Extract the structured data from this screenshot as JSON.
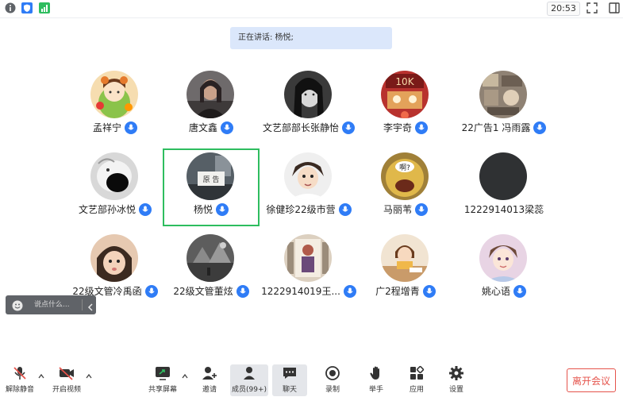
{
  "status": {
    "time": "20:53"
  },
  "speaker_banner": {
    "text": "正在讲话: 杨悦;"
  },
  "participants": [
    {
      "name": "孟祥宁",
      "avatar": "cartoon-girl-avatar",
      "bg": "#f6ddb0"
    },
    {
      "name": "唐文鑫",
      "avatar": "person-photo-avatar",
      "bg": "#6e6a6b"
    },
    {
      "name": "文艺部部长张静怡",
      "avatar": "bw-portrait-avatar",
      "bg": "#3a3a3a"
    },
    {
      "name": "李宇奇",
      "avatar": "red-poster-avatar",
      "bg": "#b8322e"
    },
    {
      "name": "22广告1 冯雨露",
      "avatar": "collage-avatar",
      "bg": "#8f8274"
    },
    {
      "name": "文艺部孙冰悦",
      "avatar": "meme-face-avatar",
      "bg": "#d8d8d8"
    },
    {
      "name": "杨悦",
      "avatar": "desk-sign-avatar",
      "bg": "#565f66",
      "sign_text": "原 告"
    },
    {
      "name": "徐健珍22级市营",
      "avatar": "cartoon-boy-avatar",
      "bg": "#efefef"
    },
    {
      "name": "马丽苇",
      "avatar": "emoji-face-avatar",
      "bg": "#a08038",
      "bubble_text": "啊?"
    },
    {
      "name": "1222914013梁蕊",
      "avatar": "dark-avatar",
      "bg": "#2f3133"
    },
    {
      "name": "22级文管冷禹函",
      "avatar": "child-photo-avatar",
      "bg": "#e6c9b1"
    },
    {
      "name": "22级文管董炫",
      "avatar": "sketch-avatar",
      "bg": "#5d5d5d"
    },
    {
      "name": "1222914019王...",
      "avatar": "illustration-avatar",
      "bg": "#dcd0c0"
    },
    {
      "name": "广2程增青",
      "avatar": "cartoon-desk-avatar",
      "bg": "#f1e4d2"
    },
    {
      "name": "姚心语",
      "avatar": "anime-avatar",
      "bg": "#e8d4e4"
    }
  ],
  "chat": {
    "placeholder": "说点什么..."
  },
  "toolbar": {
    "unmute": "解除静音",
    "start_video": "开启视频",
    "share_screen": "共享屏幕",
    "invite": "邀请",
    "members": "成员(99+)",
    "chat": "聊天",
    "record": "录制",
    "raise_hand": "举手",
    "apps": "应用",
    "settings": "设置"
  },
  "leave_button": "离开会议",
  "colors": {
    "accent": "#2f7cf6",
    "active_border": "#2ebd5f",
    "leave": "#e5534b",
    "banner_bg": "#dbe7fb"
  }
}
